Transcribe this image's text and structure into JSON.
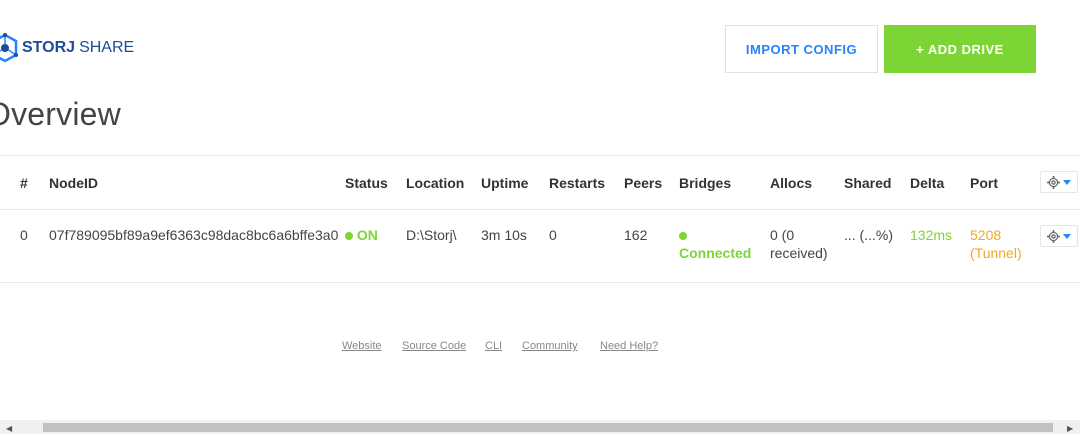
{
  "logo": {
    "bold": "STORJ",
    "light": "SHARE",
    "icon": "storj-hex-icon"
  },
  "header": {
    "import_label": "IMPORT CONFIG",
    "add_label": "+ ADD DRIVE"
  },
  "page": {
    "title": "Overview"
  },
  "table": {
    "headers": [
      "#",
      "NodeID",
      "Status",
      "Location",
      "Uptime",
      "Restarts",
      "Peers",
      "Bridges",
      "Allocs",
      "Shared",
      "Delta",
      "Port"
    ],
    "row": {
      "index": "0",
      "node_id": "07f789095bf89a9ef6363c98dac8bc6a6bffe3a0",
      "status": "ON",
      "location": "D:\\Storj\\",
      "uptime": "3m 10s",
      "restarts": "0",
      "peers": "162",
      "bridges": "Connected",
      "allocs_1": "0 (0",
      "allocs_2": "received)",
      "shared": "... (...%)",
      "delta": "132ms",
      "port_1": "5208",
      "port_2": "(Tunnel)"
    }
  },
  "footer": {
    "links": [
      "Website",
      "Source Code",
      "CLI",
      "Community",
      "Need Help?"
    ]
  },
  "colors": {
    "accent_green": "#7dd535",
    "link_blue": "#2683ff",
    "logo_blue": "#1B4B9A",
    "orange": "#f5a623"
  }
}
